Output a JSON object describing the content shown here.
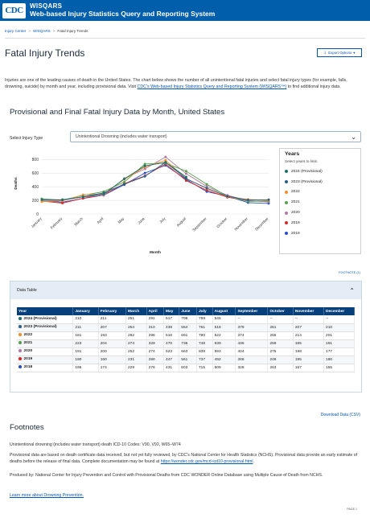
{
  "header": {
    "logo_text": "CDC",
    "title_line1": "WISQARS",
    "title_line2": "Web-based Injury Statistics Query and Reporting System"
  },
  "breadcrumb": [
    "Injury Center",
    "WISQARS",
    "Fatal Injury Trends"
  ],
  "page_title": "Fatal Injury Trends",
  "export_button": "Export Options",
  "intro": {
    "text1": "Injuries are one of the leading causes of death in the United States. The chart below shows the number of all unintentional fatal injuries and select fatal injury types (for example, falls, drowning, suicide) by month and year, including provisional data. Visit ",
    "link": "CDC's Web-based Injury Statistics Query and Reporting System (WISQARS™)",
    "text2": " to find additional injury data."
  },
  "section_title": "Provisional and Final Fatal Injury Data by Month, United States",
  "select": {
    "label": "Select Injury Type",
    "value": "Unintentional Drowning (includes water transport)"
  },
  "legend": {
    "title": "Years",
    "subtitle": "Select years to limit."
  },
  "footnote_ref": "FOOTNOTE (1)",
  "chart_data": {
    "type": "line",
    "ylabel": "Deaths",
    "xlabel": "Month",
    "ylim": [
      0,
      900
    ],
    "yticks": [
      0,
      200,
      400,
      600,
      800
    ],
    "categories": [
      "January",
      "February",
      "March",
      "April",
      "May",
      "June",
      "July",
      "August",
      "September",
      "October",
      "November",
      "December"
    ],
    "series": [
      {
        "name": "2024 (Provisional)",
        "color": "#1f6f6a",
        "values": [
          210,
          211,
          251,
          291,
          517,
          708,
          759,
          545,
          null,
          null,
          null,
          null
        ]
      },
      {
        "name": "2023 (Provisional)",
        "color": "#2c5f88",
        "values": [
          211,
          207,
          254,
          310,
          438,
          554,
          761,
          518,
          379,
          261,
          207,
          210
        ]
      },
      {
        "name": "2022",
        "color": "#f28e2b",
        "values": [
          181,
          193,
          282,
          296,
          510,
          691,
          790,
          522,
          374,
          255,
          214,
          201
        ]
      },
      {
        "name": "2021",
        "color": "#59a14f",
        "values": [
          223,
          204,
          274,
          329,
          470,
          736,
          748,
          630,
          436,
          259,
          185,
          191
        ]
      },
      {
        "name": "2020",
        "color": "#b07aa1",
        "values": [
          191,
          200,
          252,
          274,
          523,
          663,
          839,
          593,
          404,
          275,
          198,
          177
        ]
      },
      {
        "name": "2019",
        "color": "#d62728",
        "values": [
          190,
          160,
          231,
          280,
          447,
          561,
          737,
          492,
          348,
          246,
          195,
          180
        ]
      },
      {
        "name": "2018",
        "color": "#2b4fc7",
        "values": [
          195,
          174,
          229,
          276,
          431,
          603,
          715,
          509,
          328,
          263,
          167,
          155
        ]
      }
    ]
  },
  "table": {
    "title": "Data Table",
    "columns": [
      "Year",
      "January",
      "February",
      "March",
      "April",
      "May",
      "June",
      "July",
      "August",
      "September",
      "October",
      "November",
      "December"
    ],
    "rows": [
      [
        "2024 (Provisional)",
        "210",
        "211",
        "251",
        "291",
        "517",
        "708",
        "759",
        "545",
        "--",
        "--",
        "--",
        "--"
      ],
      [
        "2023 (Provisional)",
        "211",
        "207",
        "254",
        "310",
        "438",
        "554",
        "761",
        "518",
        "379",
        "261",
        "207",
        "210"
      ],
      [
        "2022",
        "181",
        "193",
        "282",
        "296",
        "510",
        "691",
        "790",
        "522",
        "374",
        "255",
        "214",
        "201"
      ],
      [
        "2021",
        "223",
        "204",
        "274",
        "329",
        "470",
        "736",
        "748",
        "630",
        "436",
        "259",
        "185",
        "191"
      ],
      [
        "2020",
        "191",
        "200",
        "252",
        "274",
        "523",
        "663",
        "839",
        "593",
        "404",
        "275",
        "198",
        "177"
      ],
      [
        "2019",
        "190",
        "160",
        "231",
        "280",
        "447",
        "561",
        "737",
        "492",
        "348",
        "246",
        "195",
        "180"
      ],
      [
        "2018",
        "195",
        "174",
        "229",
        "276",
        "431",
        "603",
        "715",
        "509",
        "328",
        "263",
        "167",
        "155"
      ]
    ]
  },
  "download": "Download Data (CSV)",
  "footnotes": {
    "title": "Footnotes",
    "p1": "Unintentional drowning (includes water transport) death ICD-10 Codes: V90, V92, W65–W74",
    "p2a": "Provisional data are based on death certificate data received, but not yet fully reviewed, by CDC's National Center for Health Statistics (NCHS). Provisional data provide an early estimate of deaths before the release of final data. Complete documentation may be found at ",
    "p2link": "https://wonder.cdc.gov/mcd-icd10-provisional.html",
    "p2b": ".",
    "p3": "Produced by: National Center for Injury Prevention and Control with Provisional Deaths from CDC WONDER Online Database using Multiple Cause of Death from NCHS.",
    "learn": "Learn more about Drowning Prevention.",
    "page": "PAGE 1"
  }
}
